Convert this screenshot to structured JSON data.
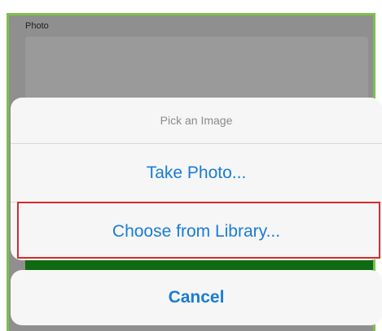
{
  "form": {
    "photo_label": "Photo"
  },
  "action_sheet": {
    "title": "Pick an Image",
    "options": [
      {
        "label": "Take Photo..."
      },
      {
        "label": "Choose from Library..."
      }
    ],
    "cancel_label": "Cancel"
  },
  "colors": {
    "accent": "#1a7cd6",
    "highlight": "#d62b2b",
    "frame": "#7fbf4d",
    "submit_button": "#0f6a12"
  }
}
